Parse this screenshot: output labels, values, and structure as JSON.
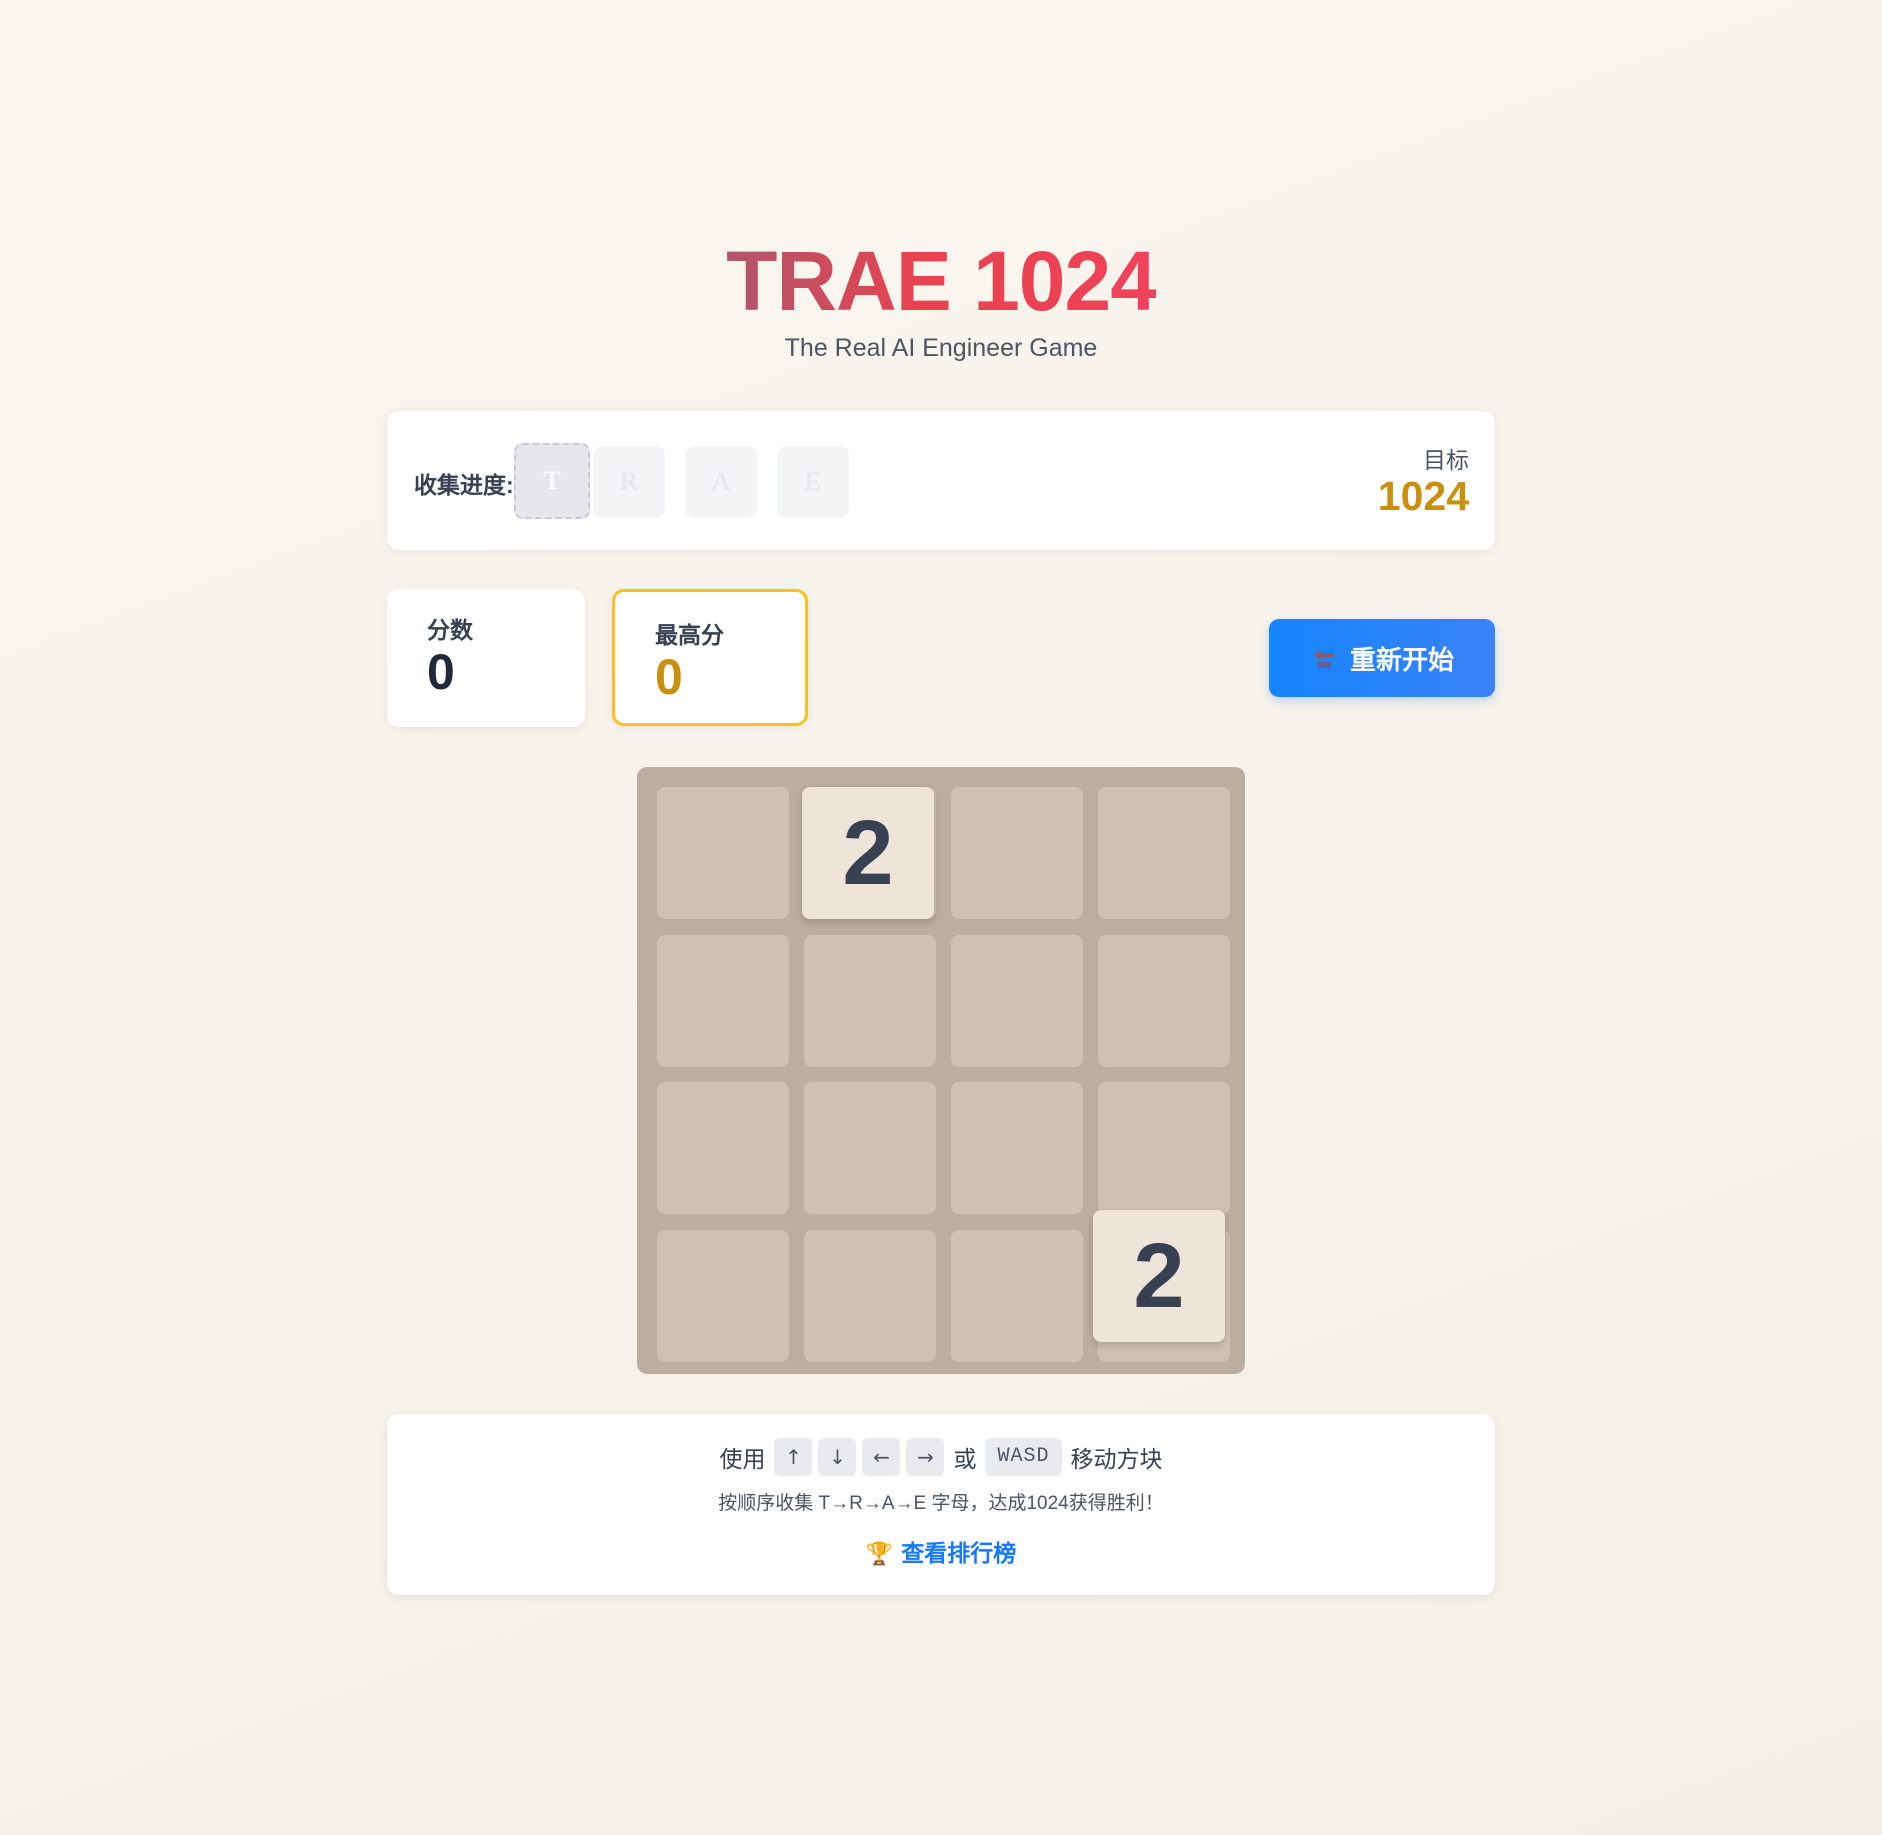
{
  "header": {
    "title": "TRAE 1024",
    "subtitle": "The Real AI Engineer Game"
  },
  "progress": {
    "label": "收集进度:",
    "letters": [
      "T",
      "R",
      "A",
      "E"
    ],
    "target_label": "目标",
    "target_value": "1024"
  },
  "stats": {
    "score_label": "分数",
    "score_value": "0",
    "best_label": "最高分",
    "best_value": "0"
  },
  "restart": {
    "label": "重新开始",
    "icon": "restart-icon"
  },
  "board": {
    "size": 4,
    "grid": [
      [
        null,
        2,
        null,
        null
      ],
      [
        null,
        null,
        null,
        null
      ],
      [
        null,
        null,
        null,
        null
      ],
      [
        null,
        null,
        null,
        2
      ]
    ]
  },
  "instructions": {
    "prefix": "使用",
    "keys": [
      "↑",
      "↓",
      "←",
      "→"
    ],
    "or": "或",
    "wasd": "WASD",
    "suffix": "移动方块",
    "description": "按顺序收集 T→R→A→E 字母，达成1024获得胜利！",
    "leaderboard_icon": "trophy-icon",
    "leaderboard_label": "查看排行榜"
  },
  "colors": {
    "accent_blue": "#1484ff",
    "gold": "#c8900e",
    "board_bg": "#bbada0",
    "cell_bg": "#cdc1b4",
    "tile_bg": "#eee4da"
  }
}
